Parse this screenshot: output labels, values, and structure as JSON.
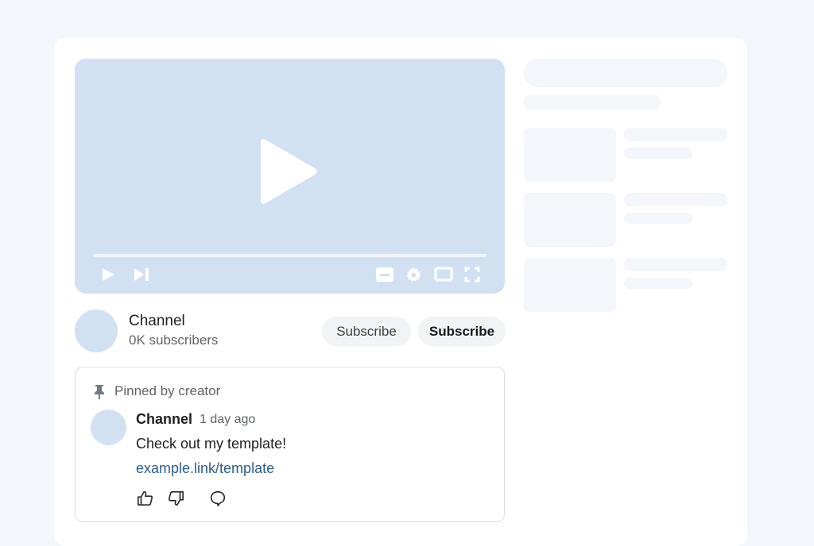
{
  "colors": {
    "page_bg": "#f3f6fa",
    "card_bg": "#ffffff",
    "player_bg": "#d2e1f2",
    "link": "#2a5d8f",
    "skeleton": "#f3f6fa"
  },
  "player": {
    "icons": [
      "play-icon",
      "play-button-icon",
      "skip-next-icon",
      "subtitles-icon",
      "settings-icon",
      "theater-mode-icon",
      "fullscreen-icon"
    ]
  },
  "channel": {
    "name": "Channel",
    "subscribers": "0K subscribers",
    "subscribe_label_1": "Subscribe",
    "subscribe_label_2": "Subscribe"
  },
  "comment": {
    "pinned_label": "Pinned by creator",
    "author": "Channel",
    "time": "1 day ago",
    "text": "Check out my template!",
    "link": "example.link/template",
    "icons": [
      "pin-icon",
      "like-icon",
      "dislike-icon",
      "reply-icon"
    ]
  }
}
